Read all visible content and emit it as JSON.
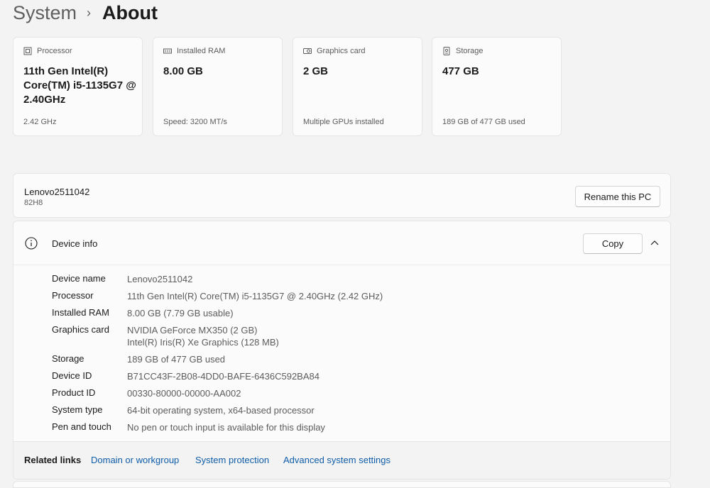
{
  "breadcrumb": {
    "parent": "System",
    "separator": "›",
    "current": "About"
  },
  "cards": [
    {
      "icon": "processor-icon",
      "label": "Processor",
      "value": "11th Gen Intel(R) Core(TM) i5-1135G7 @ 2.40GHz",
      "sub": "2.42 GHz"
    },
    {
      "icon": "ram-icon",
      "label": "Installed RAM",
      "value": "8.00 GB",
      "sub": "Speed: 3200 MT/s"
    },
    {
      "icon": "graphics-card-icon",
      "label": "Graphics card",
      "value": "2 GB",
      "sub": "Multiple GPUs installed"
    },
    {
      "icon": "storage-icon",
      "label": "Storage",
      "value": "477 GB",
      "sub": "189 GB of 477 GB used"
    }
  ],
  "pc": {
    "name": "Lenovo2511042",
    "model": "82H8",
    "rename_label": "Rename this PC"
  },
  "device_info": {
    "title": "Device info",
    "copy_label": "Copy",
    "rows": [
      {
        "key": "Device name",
        "value": "Lenovo2511042"
      },
      {
        "key": "Processor",
        "value": "11th Gen Intel(R) Core(TM) i5-1135G7 @ 2.40GHz (2.42 GHz)"
      },
      {
        "key": "Installed RAM",
        "value": "8.00 GB (7.79 GB usable)"
      },
      {
        "key": "Graphics card",
        "value": "NVIDIA GeForce MX350 (2 GB)",
        "value2": "Intel(R) Iris(R) Xe Graphics (128 MB)"
      },
      {
        "key": "Storage",
        "value": "189 GB of 477 GB used"
      },
      {
        "key": "Device ID",
        "value": "B71CC43F-2B08-4DD0-BAFE-6436C592BA84"
      },
      {
        "key": "Product ID",
        "value": "00330-80000-00000-AA002"
      },
      {
        "key": "System type",
        "value": "64-bit operating system, x64-based processor"
      },
      {
        "key": "Pen and touch",
        "value": "No pen or touch input is available for this display"
      }
    ]
  },
  "related": {
    "label": "Related links",
    "links": [
      "Domain or workgroup",
      "System protection",
      "Advanced system settings"
    ]
  },
  "colors": {
    "background": "#f3f3f3",
    "card": "#fbfbfb",
    "link": "#0f5ca8"
  }
}
